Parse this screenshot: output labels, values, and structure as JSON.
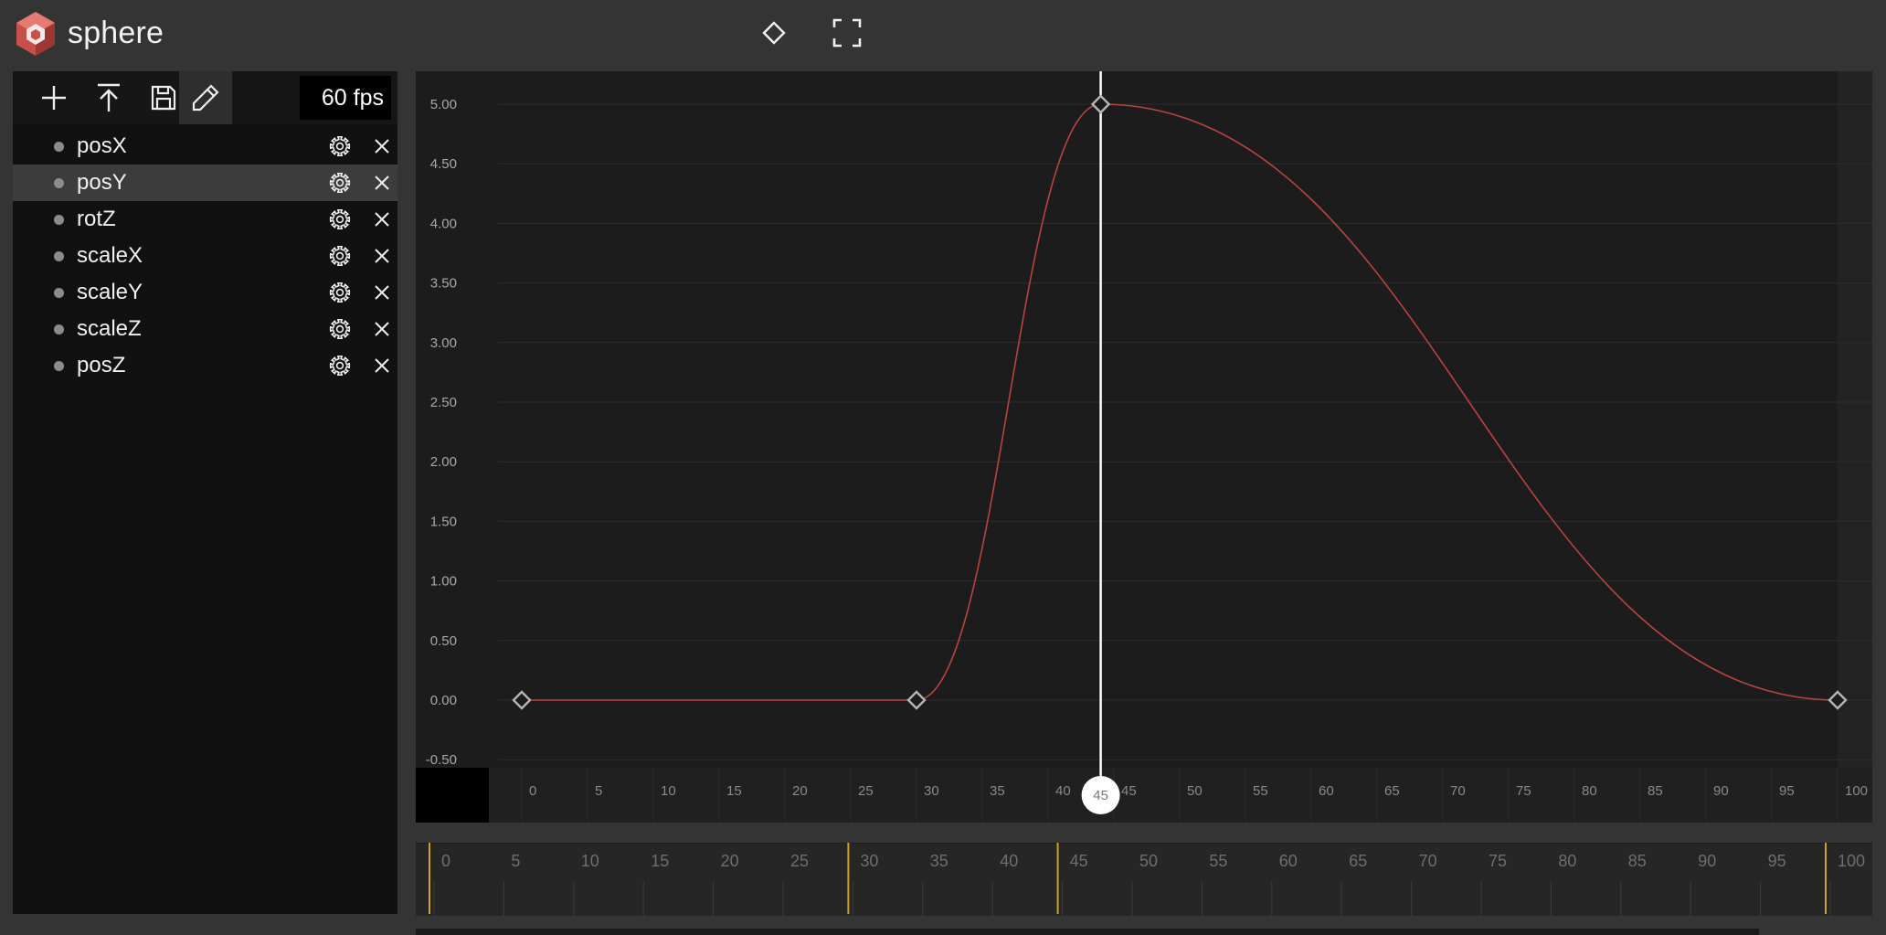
{
  "app": {
    "title": "sphere",
    "logo": "hexagon-cube-logo"
  },
  "header": {
    "buttons": [
      {
        "name": "keyframe-diamond-button",
        "icon": "diamond-icon"
      },
      {
        "name": "fullscreen-button",
        "icon": "fullscreen-icon"
      }
    ]
  },
  "toolbar": {
    "buttons": [
      "add",
      "export",
      "save",
      "edit"
    ],
    "active": "edit",
    "fps": "60 fps"
  },
  "tracks": [
    {
      "name": "posX",
      "selected": false
    },
    {
      "name": "posY",
      "selected": true
    },
    {
      "name": "rotZ",
      "selected": false
    },
    {
      "name": "scaleX",
      "selected": false
    },
    {
      "name": "scaleY",
      "selected": false
    },
    {
      "name": "scaleZ",
      "selected": false
    },
    {
      "name": "posZ",
      "selected": false
    }
  ],
  "chart_data": {
    "type": "line",
    "series": [
      {
        "color": "#b8433f",
        "keyframes": [
          {
            "x": 0,
            "y": 0
          },
          {
            "x": 30,
            "y": 0
          },
          {
            "x": 44,
            "y": 5
          },
          {
            "x": 100,
            "y": 0
          }
        ]
      }
    ],
    "y_ticks": [
      "-0.50",
      "0.00",
      "0.50",
      "1.00",
      "1.50",
      "2.00",
      "2.50",
      "3.00",
      "3.50",
      "4.00",
      "4.50",
      "5.00"
    ],
    "y_values": [
      -0.5,
      0,
      0.5,
      1,
      1.5,
      2,
      2.5,
      3,
      3.5,
      4,
      4.5,
      5
    ],
    "x_ticks": [
      "0",
      "5",
      "10",
      "15",
      "20",
      "25",
      "30",
      "35",
      "40",
      "45",
      "50",
      "55",
      "60",
      "65",
      "70",
      "75",
      "80",
      "85",
      "90",
      "95",
      "100"
    ],
    "ylim": [
      -0.5,
      5
    ],
    "xlim": [
      0,
      100
    ],
    "playhead": 44,
    "playhead_label": "45",
    "grid": true
  },
  "timeline": {
    "ticks": [
      "0",
      "5",
      "10",
      "15",
      "20",
      "25",
      "30",
      "35",
      "40",
      "45",
      "50",
      "55",
      "60",
      "65",
      "70",
      "75",
      "80",
      "85",
      "90",
      "95",
      "100"
    ],
    "markers": [
      0,
      30,
      45,
      100
    ],
    "marker_color": "#c9a227"
  }
}
